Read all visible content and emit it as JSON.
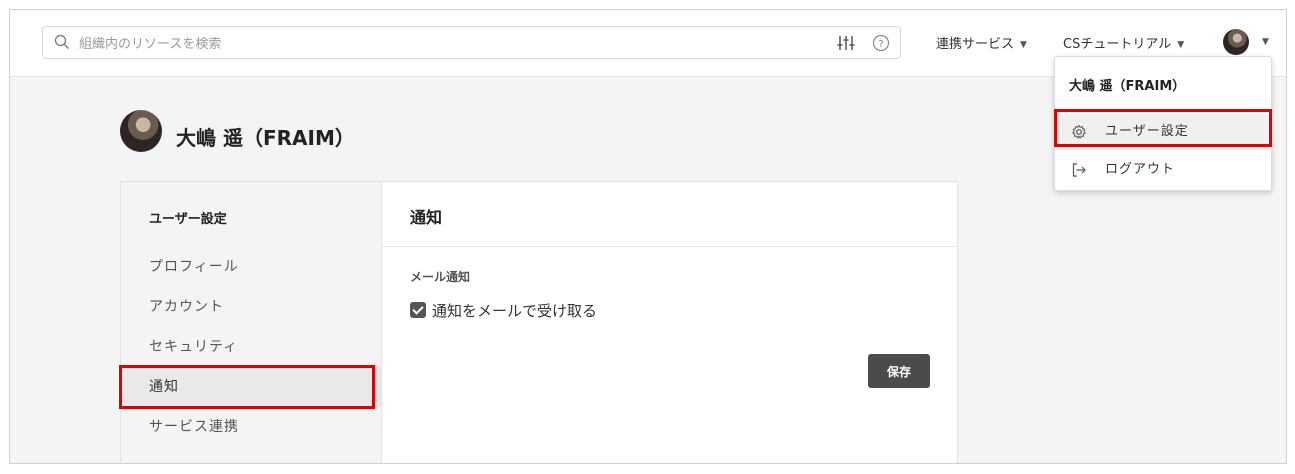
{
  "search": {
    "placeholder": "組織内のリソースを検索"
  },
  "header": {
    "nav_integrations": "連携サービス",
    "nav_workspace": "CSチュートリアル"
  },
  "profile": {
    "name": "大嶋 遥（FRAIM）"
  },
  "sidebar": {
    "title": "ユーザー設定",
    "items": [
      {
        "label": "プロフィール"
      },
      {
        "label": "アカウント"
      },
      {
        "label": "セキュリティ"
      },
      {
        "label": "通知"
      },
      {
        "label": "サービス連携"
      }
    ]
  },
  "pane": {
    "title": "通知",
    "section_label": "メール通知",
    "checkbox_label": "通知をメールで受け取る",
    "checkbox_checked": true,
    "save_label": "保存"
  },
  "user_menu": {
    "header": "大嶋 遥（FRAIM）",
    "items": [
      {
        "label": "ユーザー設定",
        "icon": "gear-icon"
      },
      {
        "label": "ログアウト",
        "icon": "logout-icon"
      }
    ]
  },
  "colors": {
    "highlight": "#e00000",
    "save_button": "#4b4b4b"
  }
}
